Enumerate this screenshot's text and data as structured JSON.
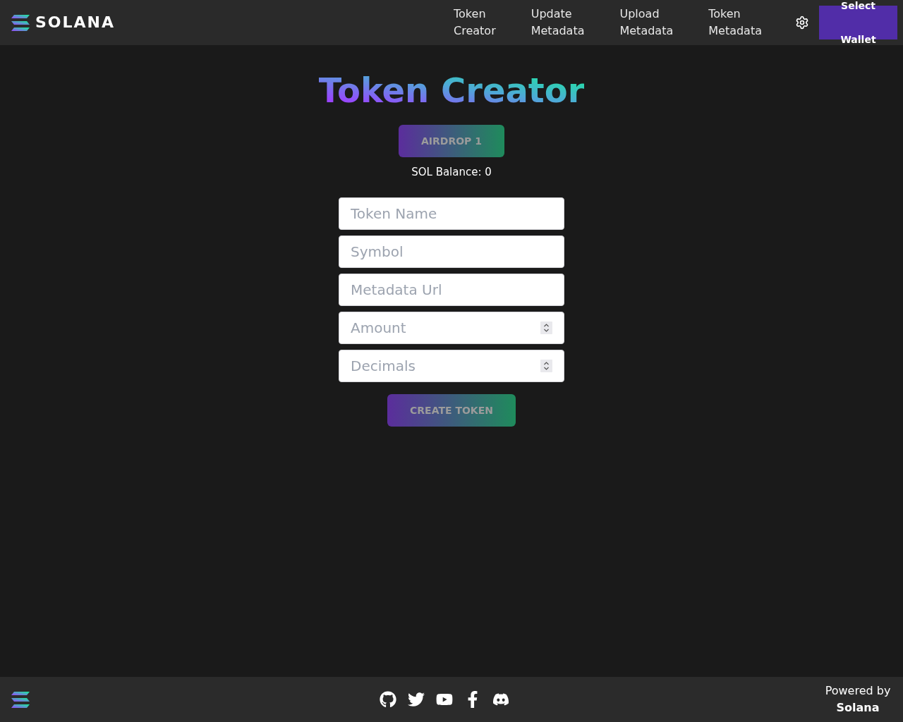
{
  "header": {
    "logo_text": "SOLANA",
    "nav_links": [
      {
        "label": "Token Creator"
      },
      {
        "label": "Update Metadata"
      },
      {
        "label": "Upload Metadata"
      },
      {
        "label": "Token Metadata"
      }
    ],
    "wallet_button": {
      "label": "Select Wallet"
    }
  },
  "main": {
    "title": "Token Creator",
    "airdrop_button": {
      "label": "AIRDROP 1",
      "disabled": true
    },
    "balance": "SOL Balance: 0",
    "fields": [
      {
        "kind": "text",
        "placeholder": "Token Name"
      },
      {
        "kind": "text",
        "placeholder": "Symbol"
      },
      {
        "kind": "text",
        "placeholder": "Metadata Url"
      },
      {
        "kind": "number",
        "placeholder": "Amount"
      },
      {
        "kind": "number",
        "placeholder": "Decimals"
      }
    ],
    "create_button": {
      "label": "CREATE TOKEN",
      "disabled": true
    }
  },
  "footer": {
    "powered_by": "Powered by **Solana**"
  }
}
